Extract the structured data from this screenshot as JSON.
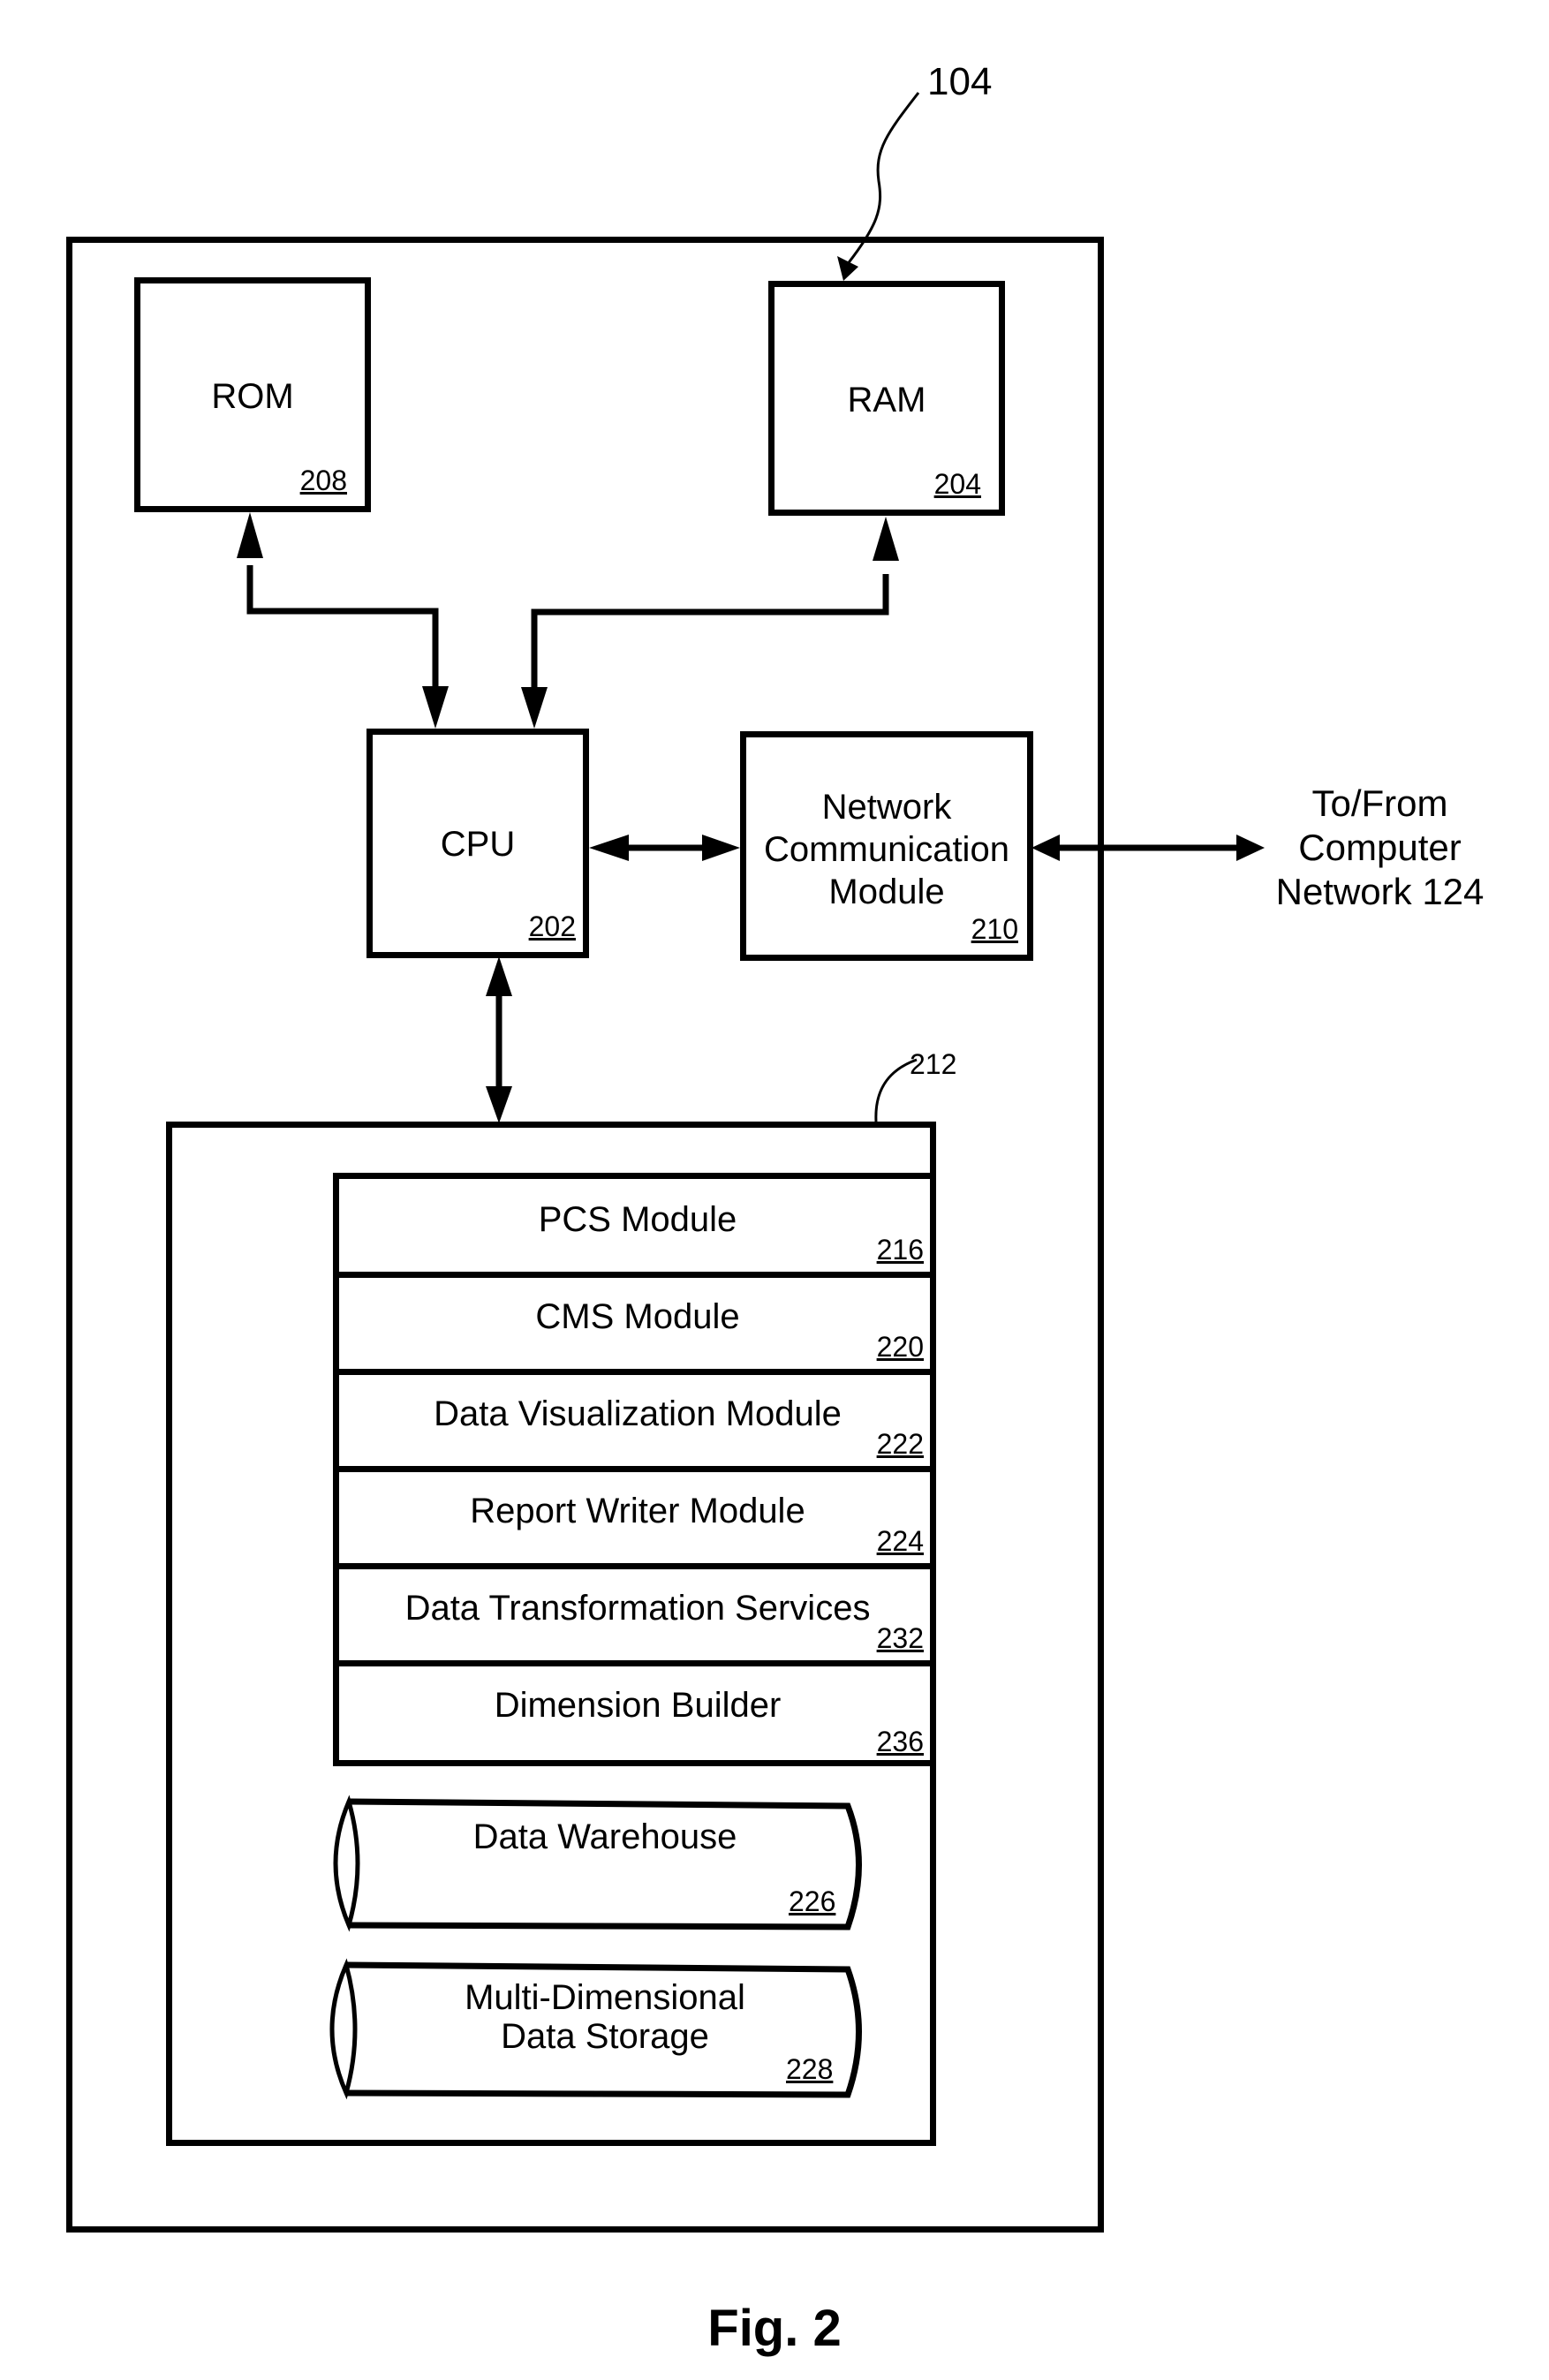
{
  "figure": {
    "caption": "Fig. 2",
    "system_ref": "104"
  },
  "components": {
    "rom": {
      "label": "ROM",
      "ref": "208"
    },
    "ram": {
      "label": "RAM",
      "ref": "204"
    },
    "cpu": {
      "label": "CPU",
      "ref": "202"
    },
    "ncm": {
      "label_lines": [
        "Network",
        "Communication",
        "Module"
      ],
      "ref": "210"
    },
    "external": {
      "label_lines": [
        "To/From",
        "Computer",
        "Network 124"
      ]
    },
    "storage_group": {
      "ref": "212"
    }
  },
  "modules": [
    {
      "label": "PCS Module",
      "ref": "216"
    },
    {
      "label": "CMS Module",
      "ref": "220"
    },
    {
      "label": "Data Visualization Module",
      "ref": "222"
    },
    {
      "label": "Report Writer Module",
      "ref": "224"
    },
    {
      "label": "Data Transformation Services",
      "ref": "232"
    },
    {
      "label": "Dimension Builder",
      "ref": "236"
    }
  ],
  "databases": [
    {
      "label_lines": [
        "Data Warehouse"
      ],
      "ref": "226"
    },
    {
      "label_lines": [
        "Multi-Dimensional",
        "Data Storage"
      ],
      "ref": "228"
    }
  ],
  "connections": [
    {
      "from": "ROM",
      "to": "CPU",
      "direction": "bidirectional"
    },
    {
      "from": "RAM",
      "to": "CPU",
      "direction": "bidirectional"
    },
    {
      "from": "CPU",
      "to": "Network Communication Module",
      "direction": "bidirectional"
    },
    {
      "from": "Network Communication Module",
      "to": "Computer Network 124",
      "direction": "bidirectional"
    },
    {
      "from": "CPU",
      "to": "212",
      "direction": "bidirectional"
    }
  ]
}
